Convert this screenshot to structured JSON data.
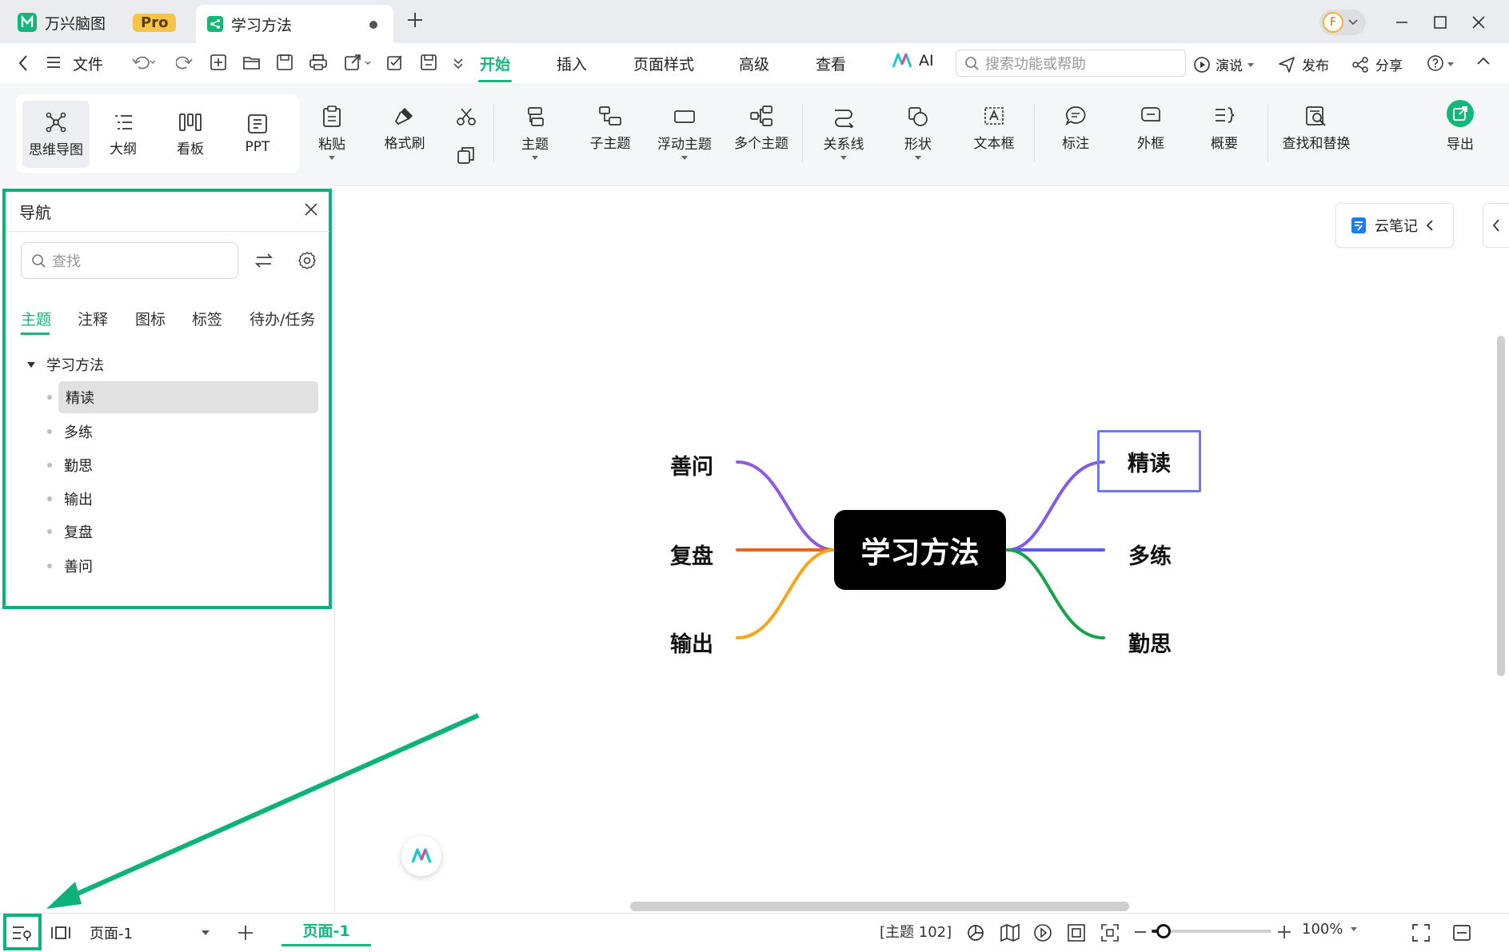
{
  "tabs": {
    "app_name": "万兴脑图",
    "pro_badge": "Pro",
    "doc_name": "学习方法"
  },
  "menu": {
    "file": "文件",
    "items": [
      "开始",
      "插入",
      "页面样式",
      "高级",
      "查看"
    ],
    "ai": "AI",
    "search_placeholder": "搜索功能或帮助",
    "present": "演说",
    "publish": "发布",
    "share": "分享"
  },
  "ribbon": {
    "views": [
      "思维导图",
      "大纲",
      "看板",
      "PPT"
    ],
    "paste": "粘贴",
    "format_painter": "格式刷",
    "topic": "主题",
    "subtopic": "子主题",
    "floating_topic": "浮动主题",
    "multiple_topics": "多个主题",
    "relationship": "关系线",
    "shape": "形状",
    "textbox": "文本框",
    "callout": "标注",
    "boundary": "外框",
    "summary": "概要",
    "find_replace": "查找和替换",
    "export": "导出"
  },
  "nav": {
    "title": "导航",
    "search_placeholder": "查找",
    "tabs": [
      "主题",
      "注释",
      "图标",
      "标签",
      "待办/任务"
    ],
    "root": "学习方法",
    "items": [
      "精读",
      "多练",
      "勤思",
      "输出",
      "复盘",
      "善问"
    ]
  },
  "canvas": {
    "cloud_note": "云笔记",
    "central": "学习方法",
    "right": [
      "精读",
      "多练",
      "勤思"
    ],
    "left": [
      "善问",
      "复盘",
      "输出"
    ]
  },
  "branch_colors": {
    "精读": "#7e5ce6",
    "多练": "#5b5bf0",
    "勤思": "#17a34a",
    "善问": "#8a5ce6",
    "复盘": "#e8632a",
    "输出": "#f4a51a"
  },
  "status": {
    "page_select": "页面-1",
    "page_tab": "页面-1",
    "topic_count": "[主题 102]",
    "zoom": "100%",
    "zoom_fraction": 0.1
  },
  "colors": {
    "accent": "#13b77a",
    "highlight_border": "#0cb277",
    "selected_topic_border": "#6c79f0"
  }
}
